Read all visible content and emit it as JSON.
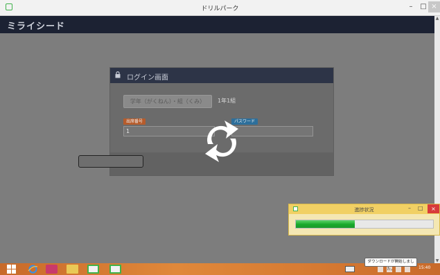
{
  "window": {
    "title": "ドリルパーク",
    "min_glyph": "–",
    "max_glyph": "□",
    "close_glyph": "×"
  },
  "brand": "ミライシード",
  "login": {
    "header": "ログイン画面",
    "class_button": "学年（がくねん）・組（くみ）",
    "class_value": "1年1組",
    "id_label": "出席番号",
    "password_label": "パスワード",
    "id_value": "1",
    "password_value": ""
  },
  "progress": {
    "title": "進捗状況",
    "value": 0.43,
    "min_glyph": "–",
    "max_glyph": "□",
    "close_glyph": "×"
  },
  "tooltip": "ダウンロードが開始しました。",
  "taskbar": {
    "clock": "15:40"
  },
  "colors": {
    "navbar": "#1c2233",
    "login_header": "#2d3447",
    "badge_id": "#b65c2c",
    "badge_password": "#2d6f9b",
    "progress_fill": "#17a82a",
    "taskbar": "#d77b33",
    "close_red": "#d83b3b"
  },
  "icons": {
    "lock": "lock-icon",
    "spinner": "refresh-icon"
  }
}
